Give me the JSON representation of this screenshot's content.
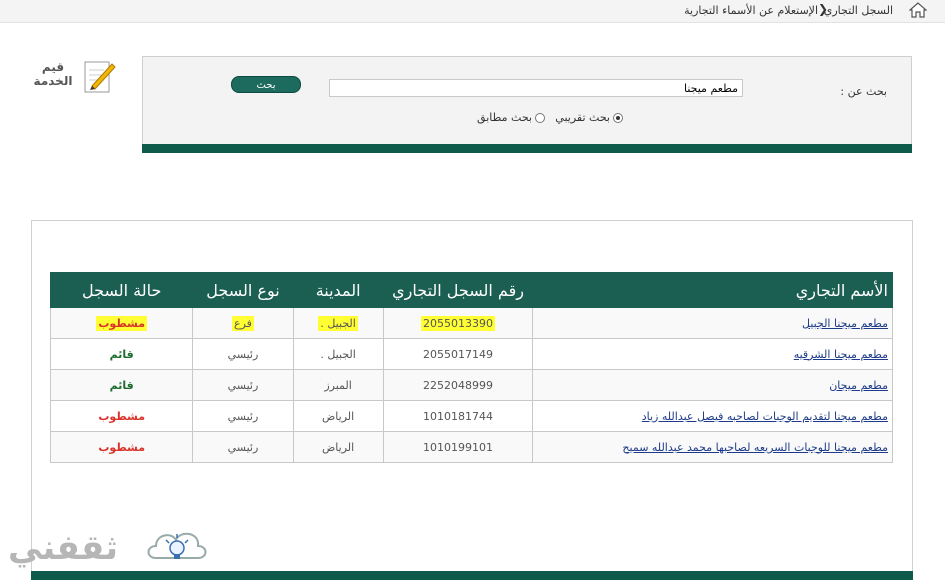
{
  "breadcrumb": {
    "home_icon": "home-icon",
    "items": [
      "السجل التجاري",
      "الإستعلام عن الأسماء التجارية"
    ],
    "separator": "❯"
  },
  "service_rating": {
    "label": "قيم الخدمة",
    "icon": "pencil-icon"
  },
  "search": {
    "label": "بحث عن :",
    "value": "مطعم ميجنا",
    "button_label": "بحث",
    "options": [
      {
        "label": "بحث تقريبي",
        "checked": true
      },
      {
        "label": "بحث مطابق",
        "checked": false
      }
    ]
  },
  "table": {
    "headers": [
      "الأسم التجاري",
      "رقم السجل التجاري",
      "المدينة",
      "نوع السجل",
      "حالة السجل"
    ],
    "rows": [
      {
        "name": "مطعم ميجنا الجبيل",
        "reg": "2055013390",
        "city": "الجبيل .",
        "type": "فرع",
        "status": "مشطوب",
        "status_color": "#d9342b",
        "highlighted": true
      },
      {
        "name": "مطعم ميجنا الشرقيه",
        "reg": "2055017149",
        "city": "الجبيل .",
        "type": "رئيسي",
        "status": "قائم",
        "status_color": "#1c6b2f",
        "highlighted": false
      },
      {
        "name": "مطعم ميجان",
        "reg": "2252048999",
        "city": "المبرز",
        "type": "رئيسي",
        "status": "قائم",
        "status_color": "#1c6b2f",
        "highlighted": false
      },
      {
        "name": "مطعم ميجنا لتقديم الوجبات لصاحبه فيصل عبدالله زياد",
        "reg": "1010181744",
        "city": "الرياض",
        "type": "رئيسي",
        "status": "مشطوب",
        "status_color": "#d9342b",
        "highlighted": false
      },
      {
        "name": "مطعم ميجنا للوجبات السريعه لصاحبها محمد عبدالله سميح",
        "reg": "1010199101",
        "city": "الرياض",
        "type": "رئيسي",
        "status": "مشطوب",
        "status_color": "#d9342b",
        "highlighted": false
      }
    ]
  },
  "colors": {
    "accent": "#0e5a4b",
    "header": "#1b5e52",
    "highlight": "#ffff33"
  },
  "watermark": {
    "text": "ثقفني",
    "icon": "lightbulb-icon"
  }
}
